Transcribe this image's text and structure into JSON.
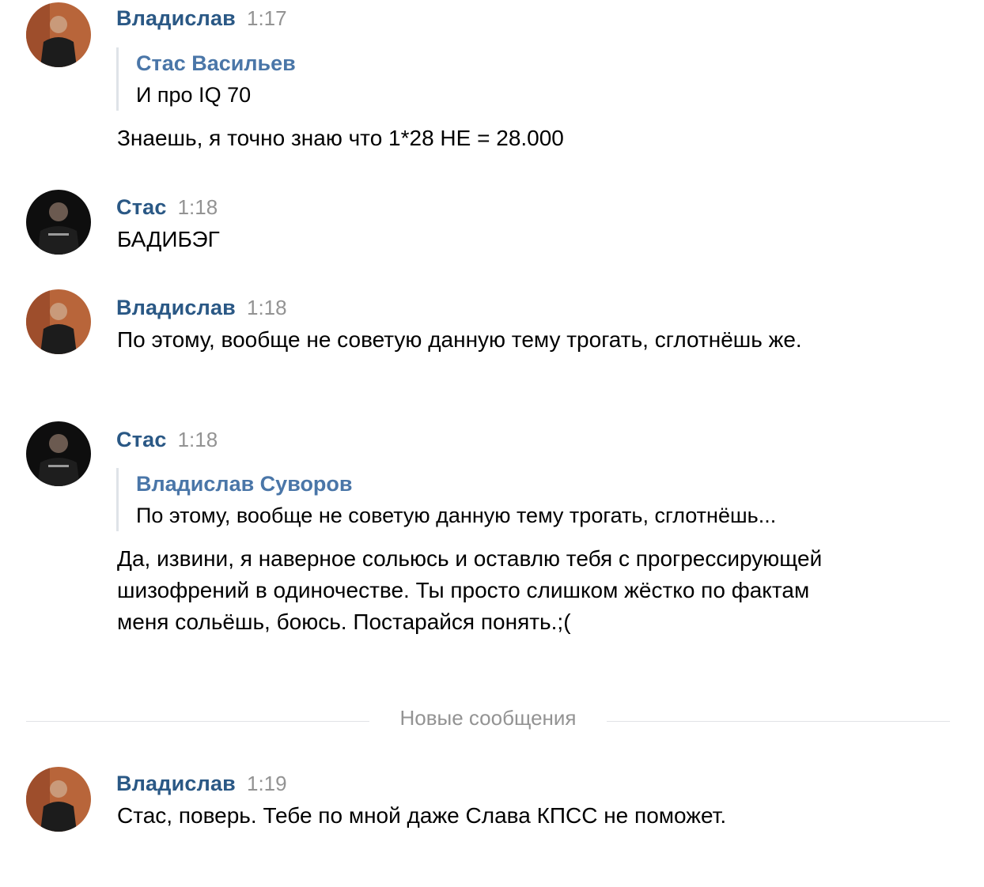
{
  "messages": [
    {
      "author": "Владислав",
      "time": "1:17",
      "avatar_icon": "user-photo-vladislav",
      "quote": {
        "author": "Стас Васильев",
        "text": "И про IQ 70"
      },
      "text": "Знаешь, я точно знаю что 1*28 НЕ = 28.000"
    },
    {
      "author": "Стас",
      "time": "1:18",
      "avatar_icon": "user-photo-stas",
      "text": "БАДИБЭГ"
    },
    {
      "author": "Владислав",
      "time": "1:18",
      "avatar_icon": "user-photo-vladislav",
      "text": "По этому, вообще не советую данную тему трогать, сглотнёшь же."
    },
    {
      "author": "Стас",
      "time": "1:18",
      "avatar_icon": "user-photo-stas",
      "quote": {
        "author": "Владислав Суворов",
        "text": "По этому, вообще не советую данную тему трогать, сглотнёшь..."
      },
      "text": "Да, извини, я наверное сольюсь и оставлю тебя с прогрессирующей шизофрений в одиночестве. Ты просто слишком жёстко по фактам меня сольёшь, боюсь. Постарайся понять.;("
    },
    {
      "author": "Владислав",
      "time": "1:19",
      "avatar_icon": "user-photo-vladislav",
      "text": "Стас, поверь. Тебе по мной даже Слава КПСС не поможет."
    }
  ],
  "new_messages_divider": "Новые сообщения",
  "colors": {
    "author": "#2a5885",
    "quote_author": "#4a76a8",
    "time": "#939393",
    "divider": "#e1e3e6"
  }
}
